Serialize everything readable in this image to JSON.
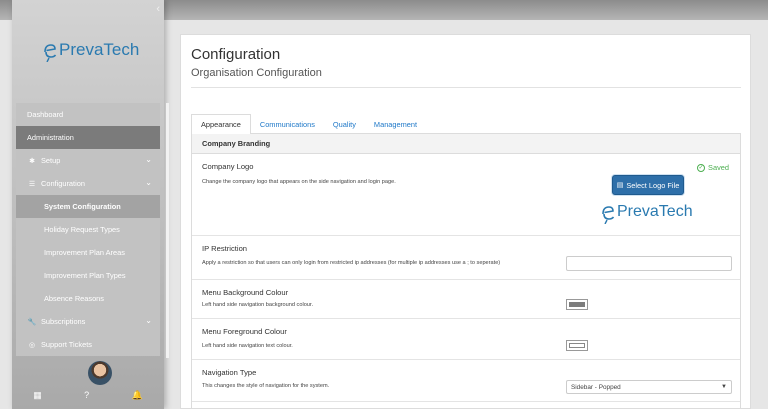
{
  "sidebar": {
    "collapse_icon": "chevron-left-icon",
    "brand_name": "PrevaTech",
    "items": [
      {
        "label": "Dashboard"
      },
      {
        "label": "Administration"
      },
      {
        "label": "Setup",
        "icon": "gear-icon"
      },
      {
        "label": "Configuration",
        "icon": "sliders-icon"
      },
      {
        "label": "System Configuration"
      },
      {
        "label": "Holiday Request Types"
      },
      {
        "label": "Improvement Plan Areas"
      },
      {
        "label": "Improvement Plan Types"
      },
      {
        "label": "Absence Reasons"
      },
      {
        "label": "Subscriptions",
        "icon": "wrench-icon"
      },
      {
        "label": "Support Tickets",
        "icon": "lifebuoy-icon"
      }
    ],
    "footer": {
      "grid": "grid-icon",
      "help": "?",
      "bell": "bell-icon"
    }
  },
  "page": {
    "title": "Configuration",
    "subtitle": "Organisation Configuration"
  },
  "tabs": [
    {
      "label": "Appearance",
      "active": true
    },
    {
      "label": "Communications"
    },
    {
      "label": "Quality"
    },
    {
      "label": "Management"
    }
  ],
  "panel": {
    "heading": "Company Branding",
    "company_logo": {
      "label": "Company Logo",
      "description": "Change the company logo that appears on the side navigation and login page.",
      "status": "Saved",
      "button": "Select Logo File",
      "brand_name": "PrevaTech"
    },
    "ip_restriction": {
      "label": "IP Restriction",
      "description": "Apply a restriction so that users can only login from restricted ip addresses (for multiple ip addresses use a ; to seperate)",
      "value": ""
    },
    "menu_background": {
      "label": "Menu Background Colour",
      "description": "Left hand side navigation background colour.",
      "color": "#7d7d7d"
    },
    "menu_foreground": {
      "label": "Menu Foreground Colour",
      "description": "Left hand side navigation text colour.",
      "color": "#ffffff"
    },
    "navigation_type": {
      "label": "Navigation Type",
      "description": "This changes the style of navigation for the system.",
      "selected": "Sidebar - Popped"
    }
  },
  "colors": {
    "accent": "#2e6fa9",
    "link": "#1e78c8",
    "saved": "#4caf50"
  }
}
